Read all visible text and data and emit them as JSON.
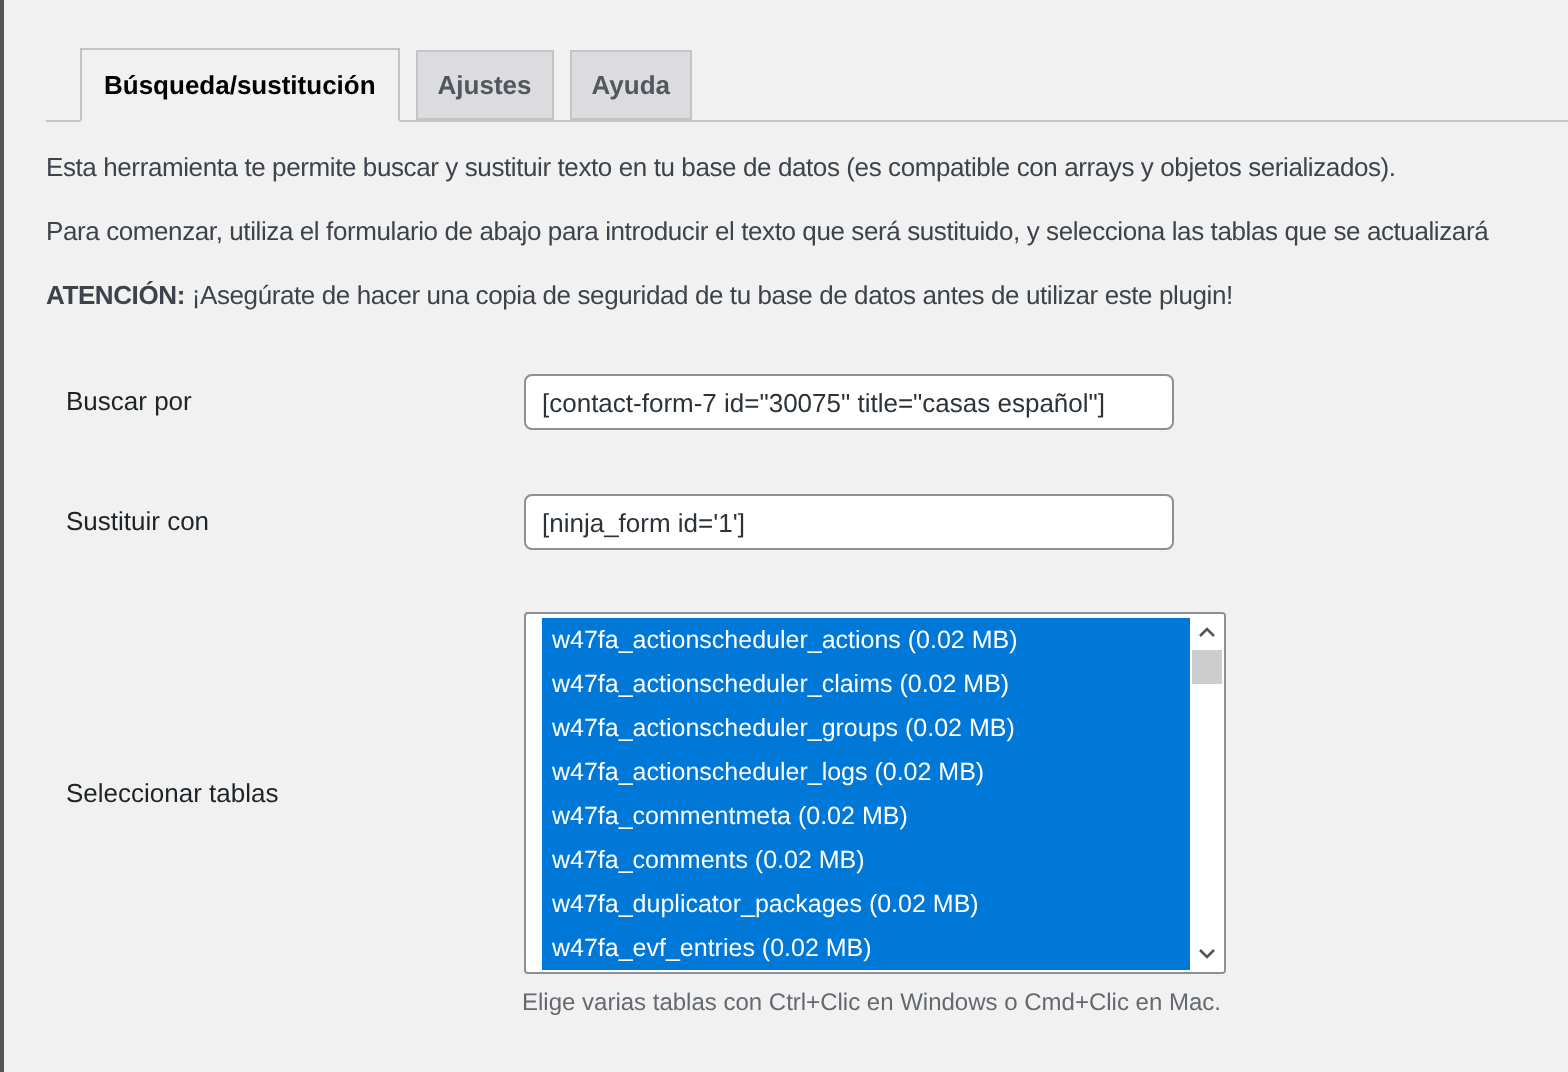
{
  "tabs": [
    {
      "label": "Búsqueda/sustitución",
      "selected": true
    },
    {
      "label": "Ajustes",
      "selected": false
    },
    {
      "label": "Ayuda",
      "selected": false
    }
  ],
  "intro": [
    "Esta herramienta te permite buscar y sustituir texto en tu base de datos (es compatible con arrays y objetos serializados).",
    "Para comenzar, utiliza el formulario de abajo para introducir el texto que será sustituido, y selecciona las tablas que se actualizará",
    "**ATENCIÓN:** ¡Asegúrate de hacer una copia de seguridad de tu base de datos antes de utilizar este plugin!"
  ],
  "form": {
    "search": {
      "label": "Buscar por",
      "value": "[contact-form-7 id=\"30075\" title=\"casas español\"]"
    },
    "replace": {
      "label": "Sustituir con",
      "value": "[ninja_form id='1']"
    },
    "tables": {
      "label": "Seleccionar tablas",
      "items": [
        {
          "label": "w47fa_actionscheduler_actions (0.02 MB)",
          "selected": true
        },
        {
          "label": "w47fa_actionscheduler_claims (0.02 MB)",
          "selected": true
        },
        {
          "label": "w47fa_actionscheduler_groups (0.02 MB)",
          "selected": true
        },
        {
          "label": "w47fa_actionscheduler_logs (0.02 MB)",
          "selected": true
        },
        {
          "label": "w47fa_commentmeta (0.02 MB)",
          "selected": true
        },
        {
          "label": "w47fa_comments (0.02 MB)",
          "selected": true
        },
        {
          "label": "w47fa_duplicator_packages (0.02 MB)",
          "selected": true
        },
        {
          "label": "w47fa_evf_entries (0.02 MB)",
          "selected": true
        }
      ],
      "hint": "Elige varias tablas con Ctrl+Clic en Windows o Cmd+Clic en Mac."
    }
  }
}
